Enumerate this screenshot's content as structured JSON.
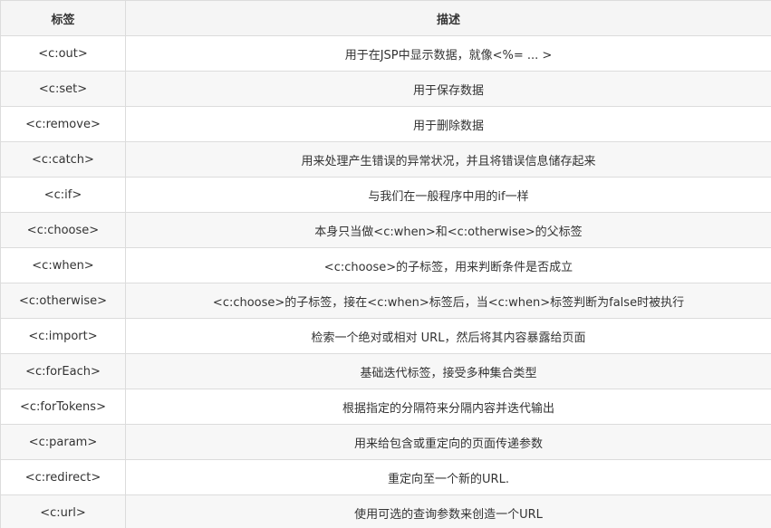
{
  "table": {
    "headers": {
      "tag": "标签",
      "description": "描述"
    },
    "rows": [
      {
        "tag": "<c:out>",
        "description": "用于在JSP中显示数据，就像<%= ... >"
      },
      {
        "tag": "<c:set>",
        "description": "用于保存数据"
      },
      {
        "tag": "<c:remove>",
        "description": "用于删除数据"
      },
      {
        "tag": "<c:catch>",
        "description": "用来处理产生错误的异常状况，并且将错误信息储存起来"
      },
      {
        "tag": "<c:if>",
        "description": "与我们在一般程序中用的if一样"
      },
      {
        "tag": "<c:choose>",
        "description": "本身只当做<c:when>和<c:otherwise>的父标签"
      },
      {
        "tag": "<c:when>",
        "description": "<c:choose>的子标签，用来判断条件是否成立"
      },
      {
        "tag": "<c:otherwise>",
        "description": "<c:choose>的子标签，接在<c:when>标签后，当<c:when>标签判断为false时被执行"
      },
      {
        "tag": "<c:import>",
        "description": "检索一个绝对或相对 URL，然后将其内容暴露给页面"
      },
      {
        "tag": "<c:forEach>",
        "description": "基础迭代标签，接受多种集合类型"
      },
      {
        "tag": "<c:forTokens>",
        "description": "根据指定的分隔符来分隔内容并迭代输出"
      },
      {
        "tag": "<c:param>",
        "description": "用来给包含或重定向的页面传递参数"
      },
      {
        "tag": "<c:redirect>",
        "description": "重定向至一个新的URL."
      },
      {
        "tag": "<c:url>",
        "description": "使用可选的查询参数来创造一个URL"
      }
    ]
  }
}
